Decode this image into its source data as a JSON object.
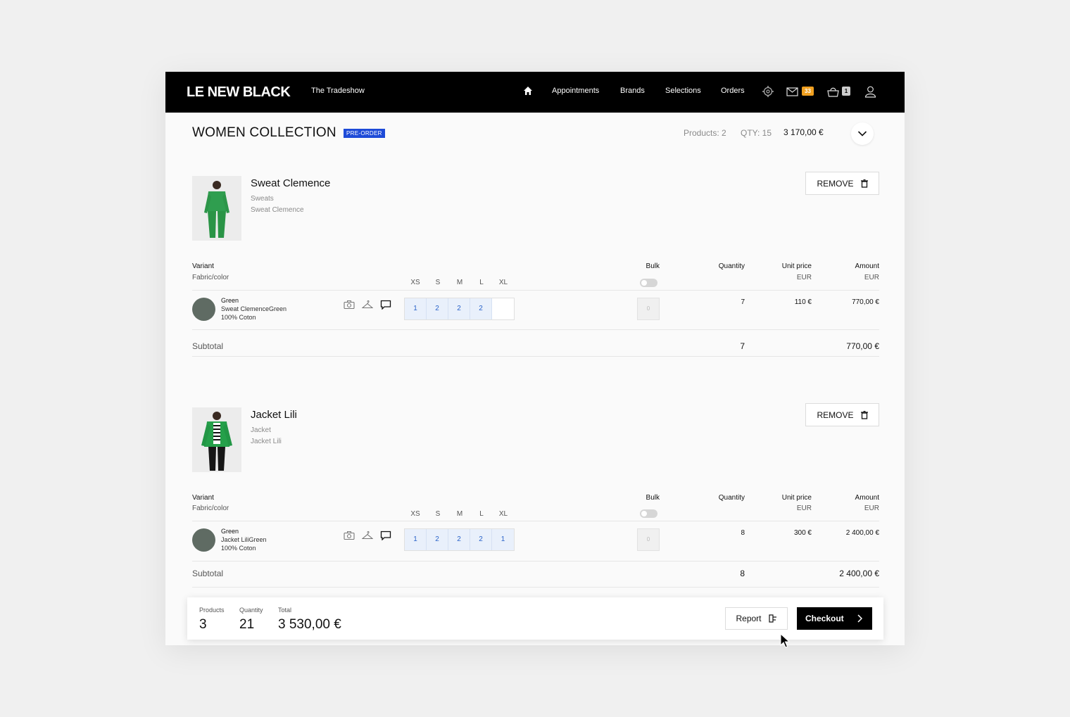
{
  "header": {
    "logo": "LE NEW BLACK",
    "event": "The Tradeshow",
    "nav": [
      "Appointments",
      "Brands",
      "Selections",
      "Orders"
    ],
    "inbox_badge": "33",
    "cart_badge": "1"
  },
  "collection": {
    "title": "WOMEN COLLECTION",
    "tag": "PRE-ORDER",
    "products_label": "Products: 2",
    "qty_label": "QTY: 15",
    "total": "3 170,00 €"
  },
  "table_headers": {
    "variant": "Variant",
    "fabric": "Fabric/color",
    "sizes": [
      "XS",
      "S",
      "M",
      "L",
      "XL"
    ],
    "bulk": "Bulk",
    "quantity": "Quantity",
    "unit_price": "Unit price",
    "amount": "Amount",
    "currency": "EUR",
    "subtotal": "Subtotal"
  },
  "products": [
    {
      "name": "Sweat Clemence",
      "category": "Sweats",
      "subname": "Sweat Clemence",
      "remove_label": "REMOVE",
      "variant": {
        "color": "Green",
        "ref": "Sweat ClemenceGreen",
        "fabric": "100% Coton"
      },
      "sizes": [
        "1",
        "2",
        "2",
        "2",
        ""
      ],
      "bulk_value": "0",
      "quantity": "7",
      "unit_price": "110 €",
      "amount": "770,00 €",
      "subtotal_qty": "7",
      "subtotal_amount": "770,00 €"
    },
    {
      "name": "Jacket Lili",
      "category": "Jacket",
      "subname": "Jacket Lili",
      "remove_label": "REMOVE",
      "variant": {
        "color": "Green",
        "ref": "Jacket LiliGreen",
        "fabric": "100% Coton"
      },
      "sizes": [
        "1",
        "2",
        "2",
        "2",
        "1"
      ],
      "bulk_value": "0",
      "quantity": "8",
      "unit_price": "300 €",
      "amount": "2 400,00 €",
      "subtotal_qty": "8",
      "subtotal_amount": "2 400,00 €"
    }
  ],
  "footer": {
    "products_label": "Products",
    "products_value": "3",
    "quantity_label": "Quantity",
    "quantity_value": "21",
    "total_label": "Total",
    "total_value": "3 530,00 €",
    "report_label": "Report",
    "checkout_label": "Checkout"
  },
  "colors": {
    "accent": "#1e4bd8",
    "badge": "#f0a020",
    "swatch": "#5f6b63",
    "product_green": "#2f9e4f"
  }
}
